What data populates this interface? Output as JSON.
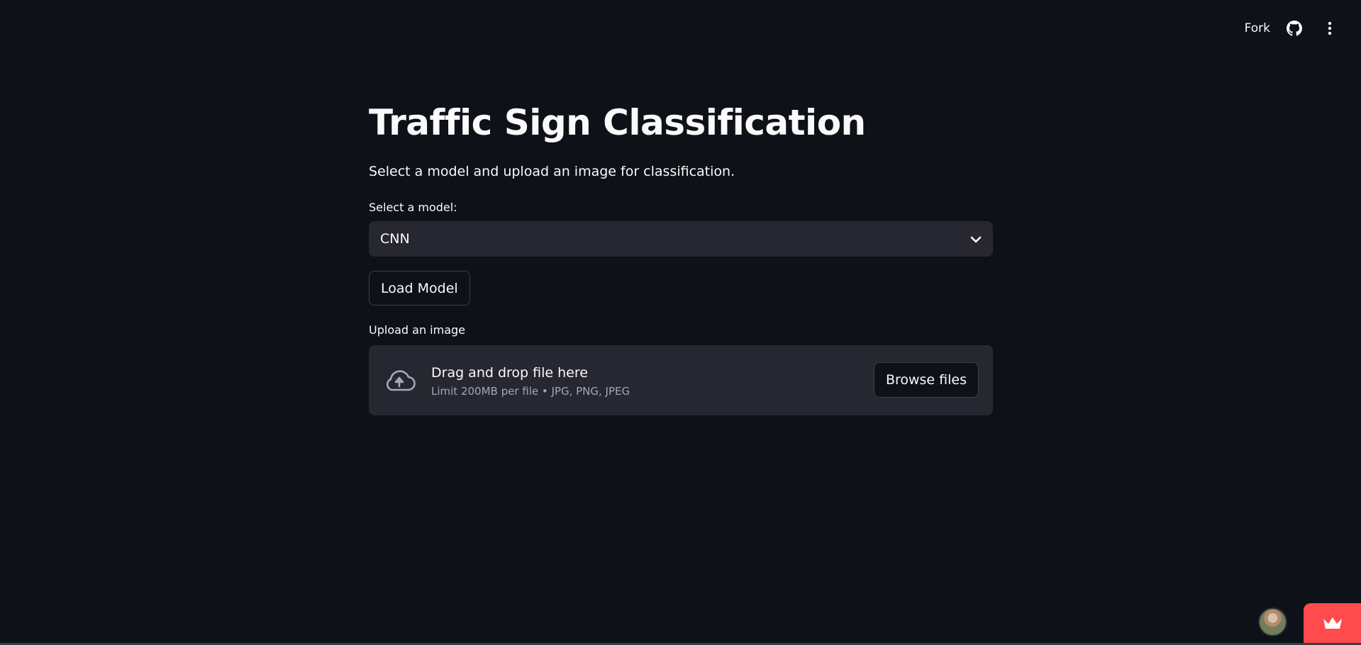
{
  "toolbar": {
    "fork_label": "Fork",
    "icons": [
      "github-icon",
      "more-vertical-icon"
    ]
  },
  "main": {
    "title": "Traffic Sign Classification",
    "subtitle": "Select a model and upload an image for classification.",
    "model_select": {
      "label": "Select a model:",
      "value": "CNN"
    },
    "load_button_label": "Load Model",
    "upload": {
      "label": "Upload an image",
      "primary_text": "Drag and drop file here",
      "secondary_text": "Limit 200MB per file • JPG, PNG, JPEG",
      "browse_label": "Browse files"
    }
  },
  "colors": {
    "background": "#0e1117",
    "surface": "#262730",
    "accent": "#ff4b4b",
    "text": "#fafafa",
    "muted_text": "#a3a8b8"
  }
}
